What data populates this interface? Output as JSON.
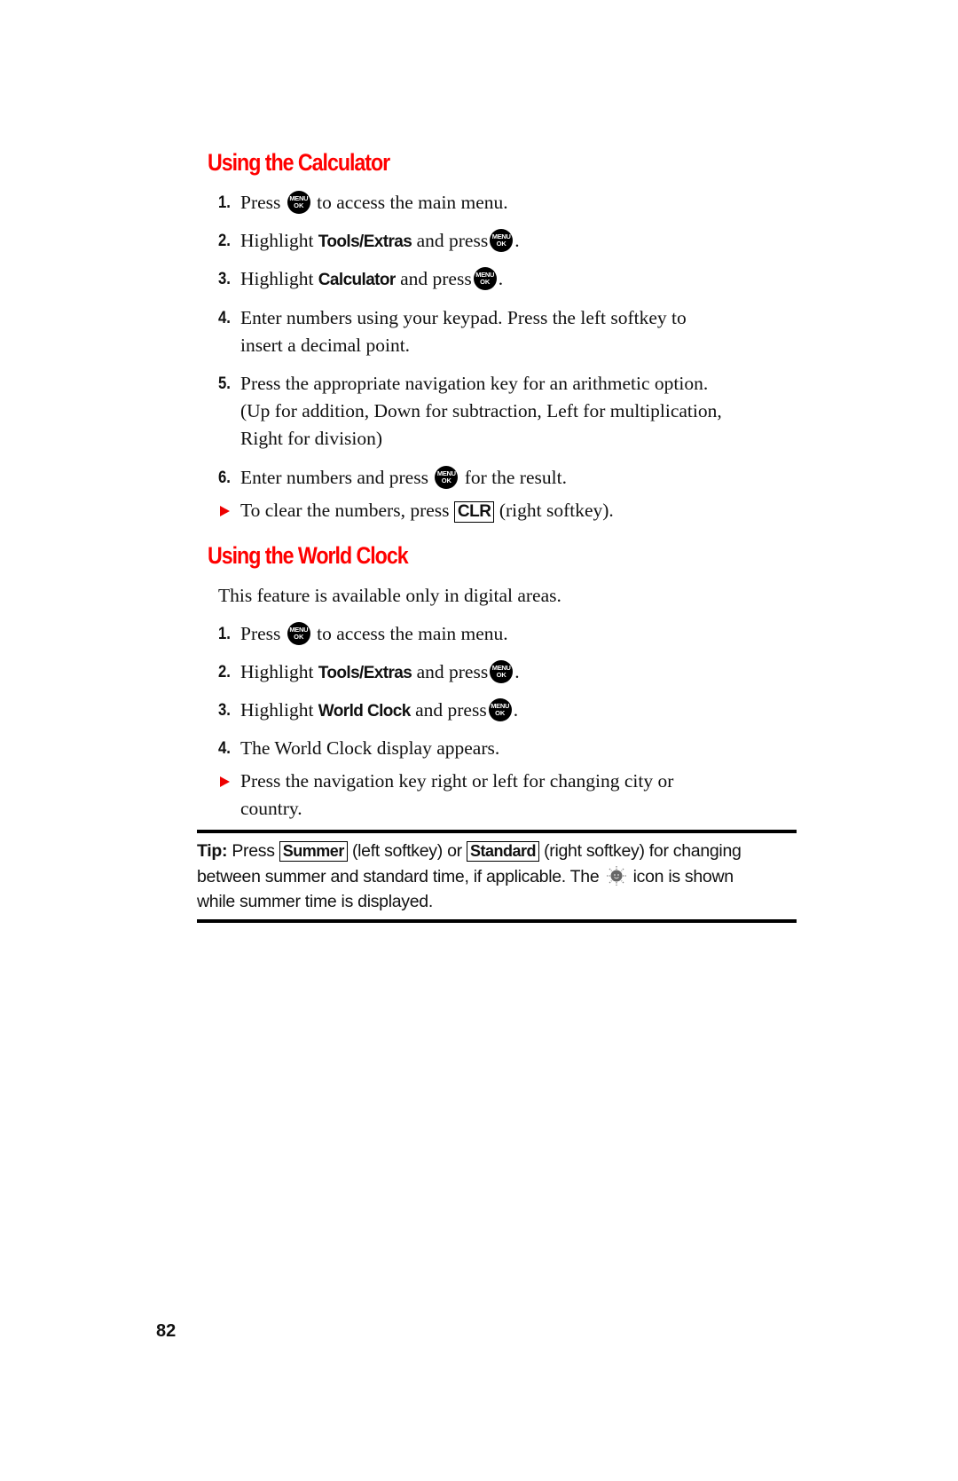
{
  "page_number": "82",
  "sections": [
    {
      "title": "Using the Calculator",
      "steps": [
        {
          "num": "1.",
          "pre": "Press",
          "key": "MENU/OK",
          "post": "to access the main menu."
        },
        {
          "num": "2.",
          "pre": "Highlight",
          "bold": "Tools/Extras",
          "mid": "and press",
          "key": "MENU/OK",
          "post": "."
        },
        {
          "num": "3.",
          "pre": "Highlight",
          "bold": "Calculator",
          "mid": "and press",
          "key": "MENU/OK",
          "post": "."
        },
        {
          "num": "4.",
          "lines": [
            "Enter numbers using your keypad. Press the left softkey to",
            "insert a decimal point."
          ]
        },
        {
          "num": "5.",
          "lines": [
            "Press the appropriate navigation key for an arithmetic option.",
            "(Up for addition, Down for subtraction, Left for multiplication,",
            "Right for division)"
          ]
        },
        {
          "num": "6.",
          "pre": "Enter numbers and press",
          "key": "MENU/OK",
          "post": "for the result."
        }
      ],
      "bullet": {
        "pre": "To clear the numbers, press",
        "softkey": "CLR",
        "post": "(right softkey)."
      }
    },
    {
      "title": "Using the World Clock",
      "intro": "This feature is available only in digital areas.",
      "steps": [
        {
          "num": "1.",
          "pre": "Press",
          "key": "MENU/OK",
          "post": "to access the main menu."
        },
        {
          "num": "2.",
          "pre": "Highlight",
          "bold": "Tools/Extras",
          "mid": "and press",
          "key": "MENU/OK",
          "post": "."
        },
        {
          "num": "3.",
          "pre": "Highlight",
          "bold": "World Clock",
          "mid": "and press",
          "key": "MENU/OK",
          "post": "."
        },
        {
          "num": "4.",
          "text": "The World Clock display appears."
        }
      ],
      "bullet": {
        "lines": [
          "Press the navigation key right or left for changing city or",
          "country."
        ]
      }
    }
  ],
  "menu_key": {
    "top": "MENU",
    "bottom": "OK"
  },
  "tip": {
    "label": "Tip:",
    "press": "Press",
    "softkey_left": "Summer",
    "mid1": "(left softkey) or",
    "softkey_right": "Standard",
    "mid2": "(right softkey) for changing",
    "line2_pre": "between summer and standard time, if applicable. The",
    "icon": "summer-time-sun-icon",
    "line2_post": "icon is shown",
    "line3": "while summer time is displayed."
  },
  "colors": {
    "heading": "#ff0000",
    "bullet": "#ee0000",
    "text": "#111111"
  }
}
